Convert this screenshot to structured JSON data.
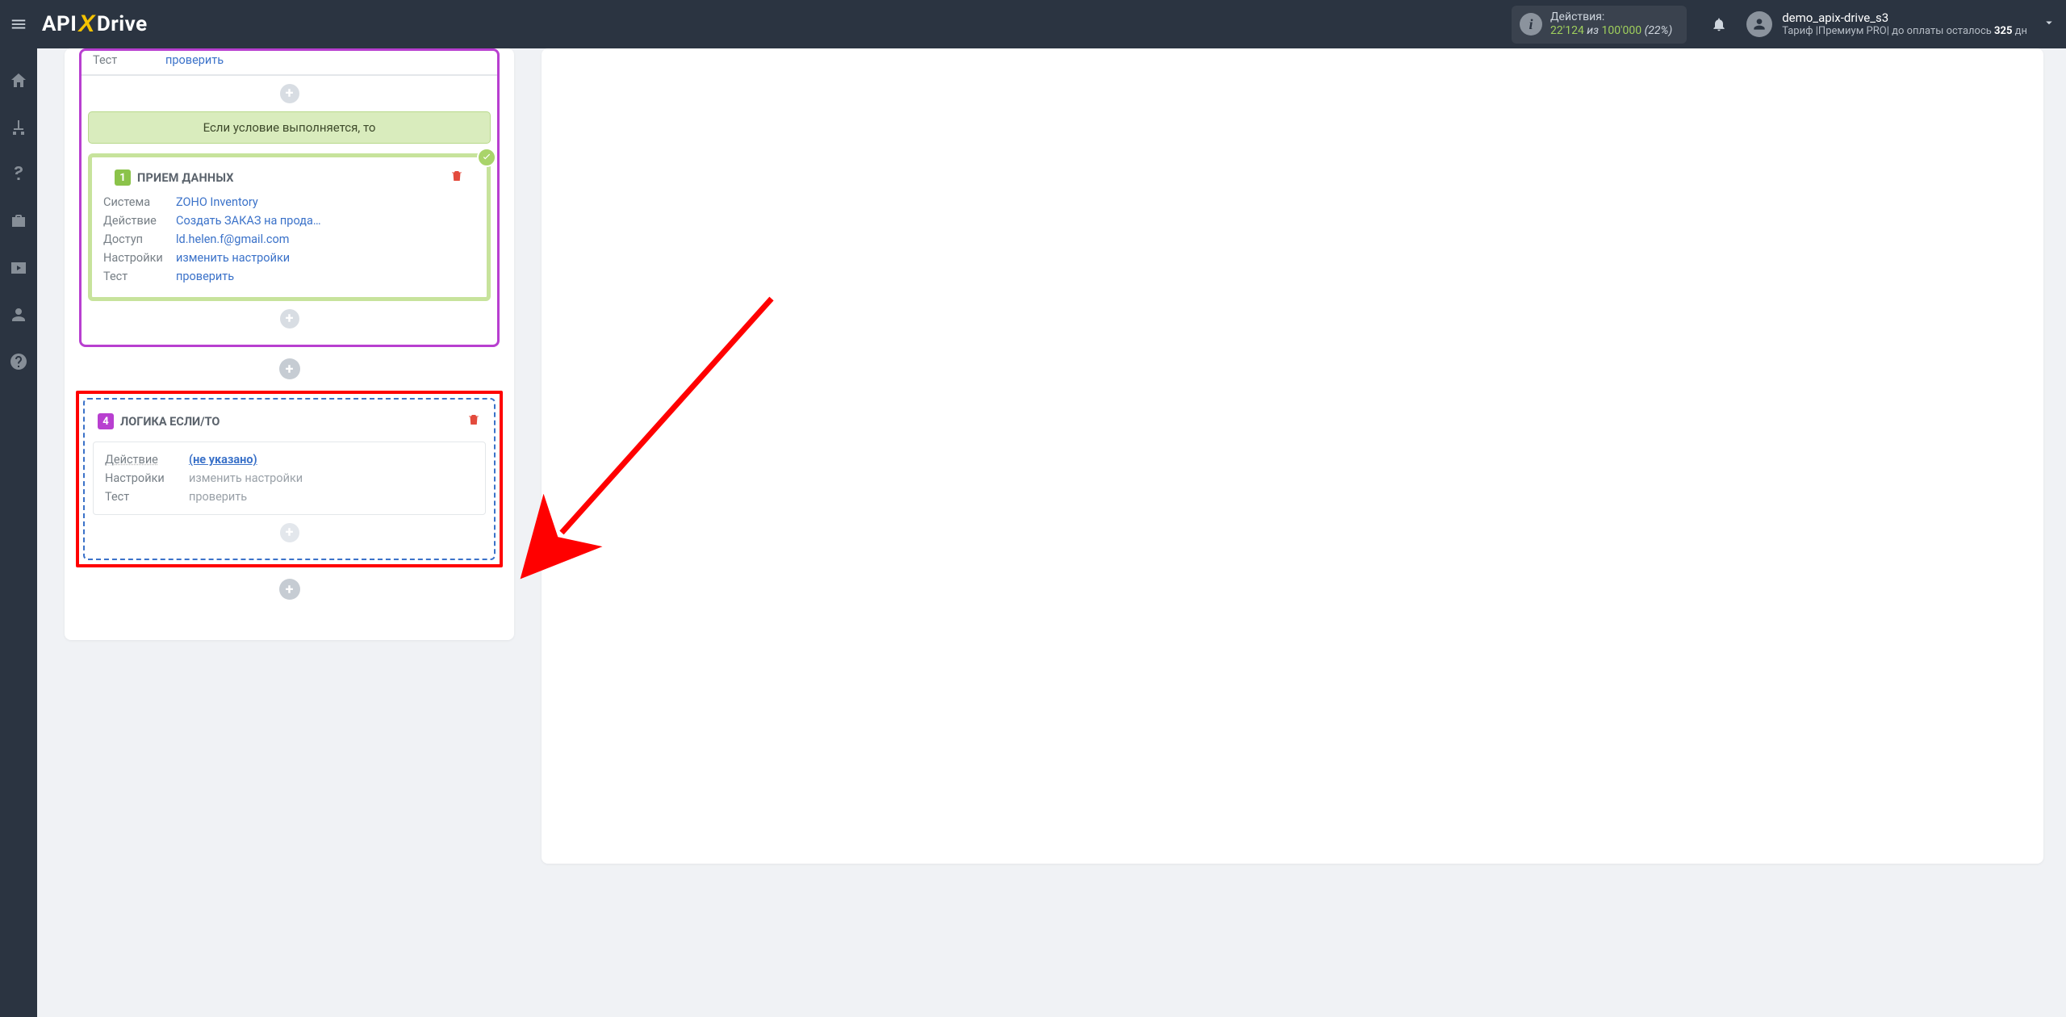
{
  "header": {
    "logo_a": "API",
    "logo_b": "X",
    "logo_c": "Drive",
    "actions_label": "Действия:",
    "actions_cur": "22'124",
    "actions_sep": " из ",
    "actions_max": "100'000",
    "actions_pct": "(22%)",
    "username": "demo_apix-drive_s3",
    "plan_prefix": "Тариф |Премиум PRO| до оплаты осталось ",
    "plan_days": "325",
    "plan_suffix": " дн"
  },
  "top": {
    "test_key": "Тест",
    "test_link": "проверить"
  },
  "cond": "Если условие выполняется, то",
  "card1": {
    "num": "1",
    "title": "ПРИЕМ ДАННЫХ",
    "rows": {
      "system_k": "Система",
      "system_v": "ZOHO Inventory",
      "action_k": "Действие",
      "action_v": "Создать ЗАКАЗ на продажу",
      "access_k": "Доступ",
      "access_v": "ld.helen.f@gmail.com",
      "settings_k": "Настройки",
      "settings_v": "изменить настройки",
      "test_k": "Тест",
      "test_v": "проверить"
    }
  },
  "logic": {
    "num": "4",
    "title": "ЛОГИКА ЕСЛИ/ТО",
    "rows": {
      "action_k": "Действие",
      "action_v": "(не указано)",
      "settings_k": "Настройки",
      "settings_v": "изменить настройки",
      "test_k": "Тест",
      "test_v": "проверить"
    }
  }
}
